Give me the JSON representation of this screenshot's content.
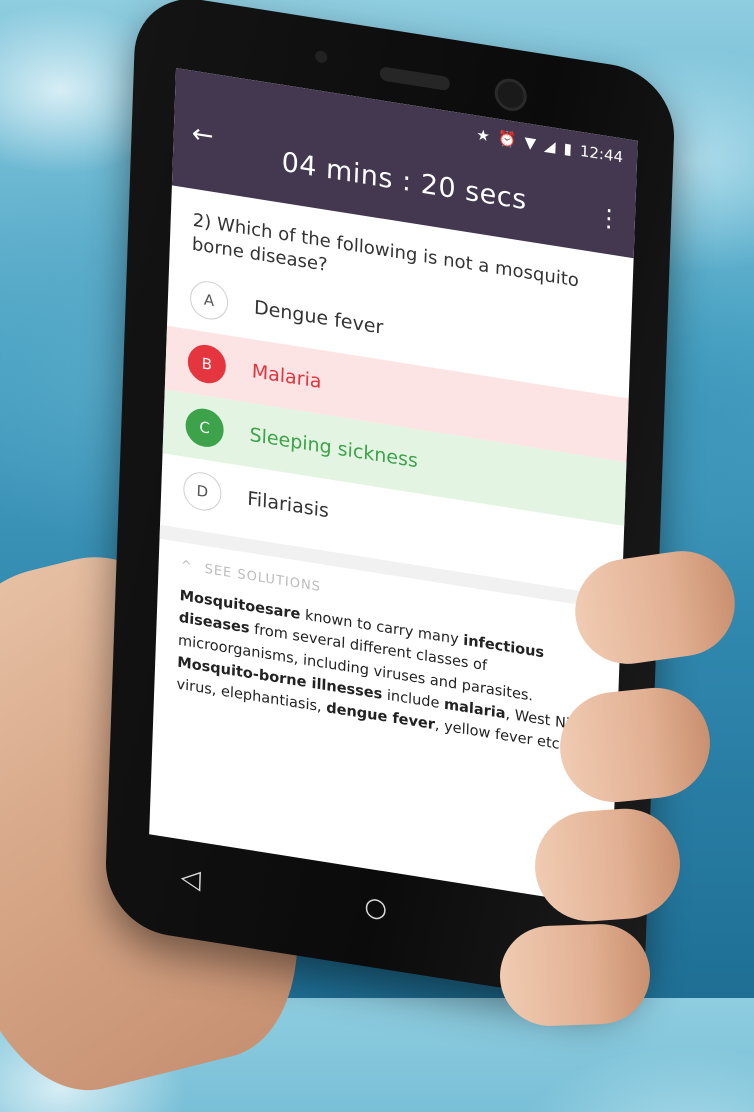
{
  "status_bar": {
    "icons": [
      "star-icon",
      "alarm-icon",
      "wifi-icon",
      "signal-icon",
      "battery-icon"
    ],
    "time": "12:44"
  },
  "app_bar": {
    "timer": "04 mins : 20 secs"
  },
  "question": {
    "text": "2) Which of the following is not a mosquito borne disease?"
  },
  "options": [
    {
      "letter": "A",
      "text": "Dengue fever",
      "state": "neutral"
    },
    {
      "letter": "B",
      "text": "Malaria",
      "state": "wrong"
    },
    {
      "letter": "C",
      "text": "Sleeping sickness",
      "state": "correct"
    },
    {
      "letter": "D",
      "text": "Filariasis",
      "state": "neutral"
    }
  ],
  "solutions": {
    "header": "SEE SOLUTIONS",
    "segments": [
      {
        "text": "Mosquitoesare",
        "bold": true
      },
      {
        "text": " known to carry many ",
        "bold": false
      },
      {
        "text": "infectious diseases",
        "bold": true
      },
      {
        "text": " from several different classes of microorganisms, including viruses and parasites. ",
        "bold": false
      },
      {
        "text": "Mosquito-borne illnesses",
        "bold": true
      },
      {
        "text": " include ",
        "bold": false
      },
      {
        "text": "malaria",
        "bold": true
      },
      {
        "text": ", West Nile virus, elephantiasis, ",
        "bold": false
      },
      {
        "text": "dengue fever",
        "bold": true
      },
      {
        "text": ", yellow fever etc.",
        "bold": false
      }
    ]
  },
  "colors": {
    "app_bar": "#43384f",
    "wrong": "#e53640",
    "correct": "#3ca34a"
  }
}
